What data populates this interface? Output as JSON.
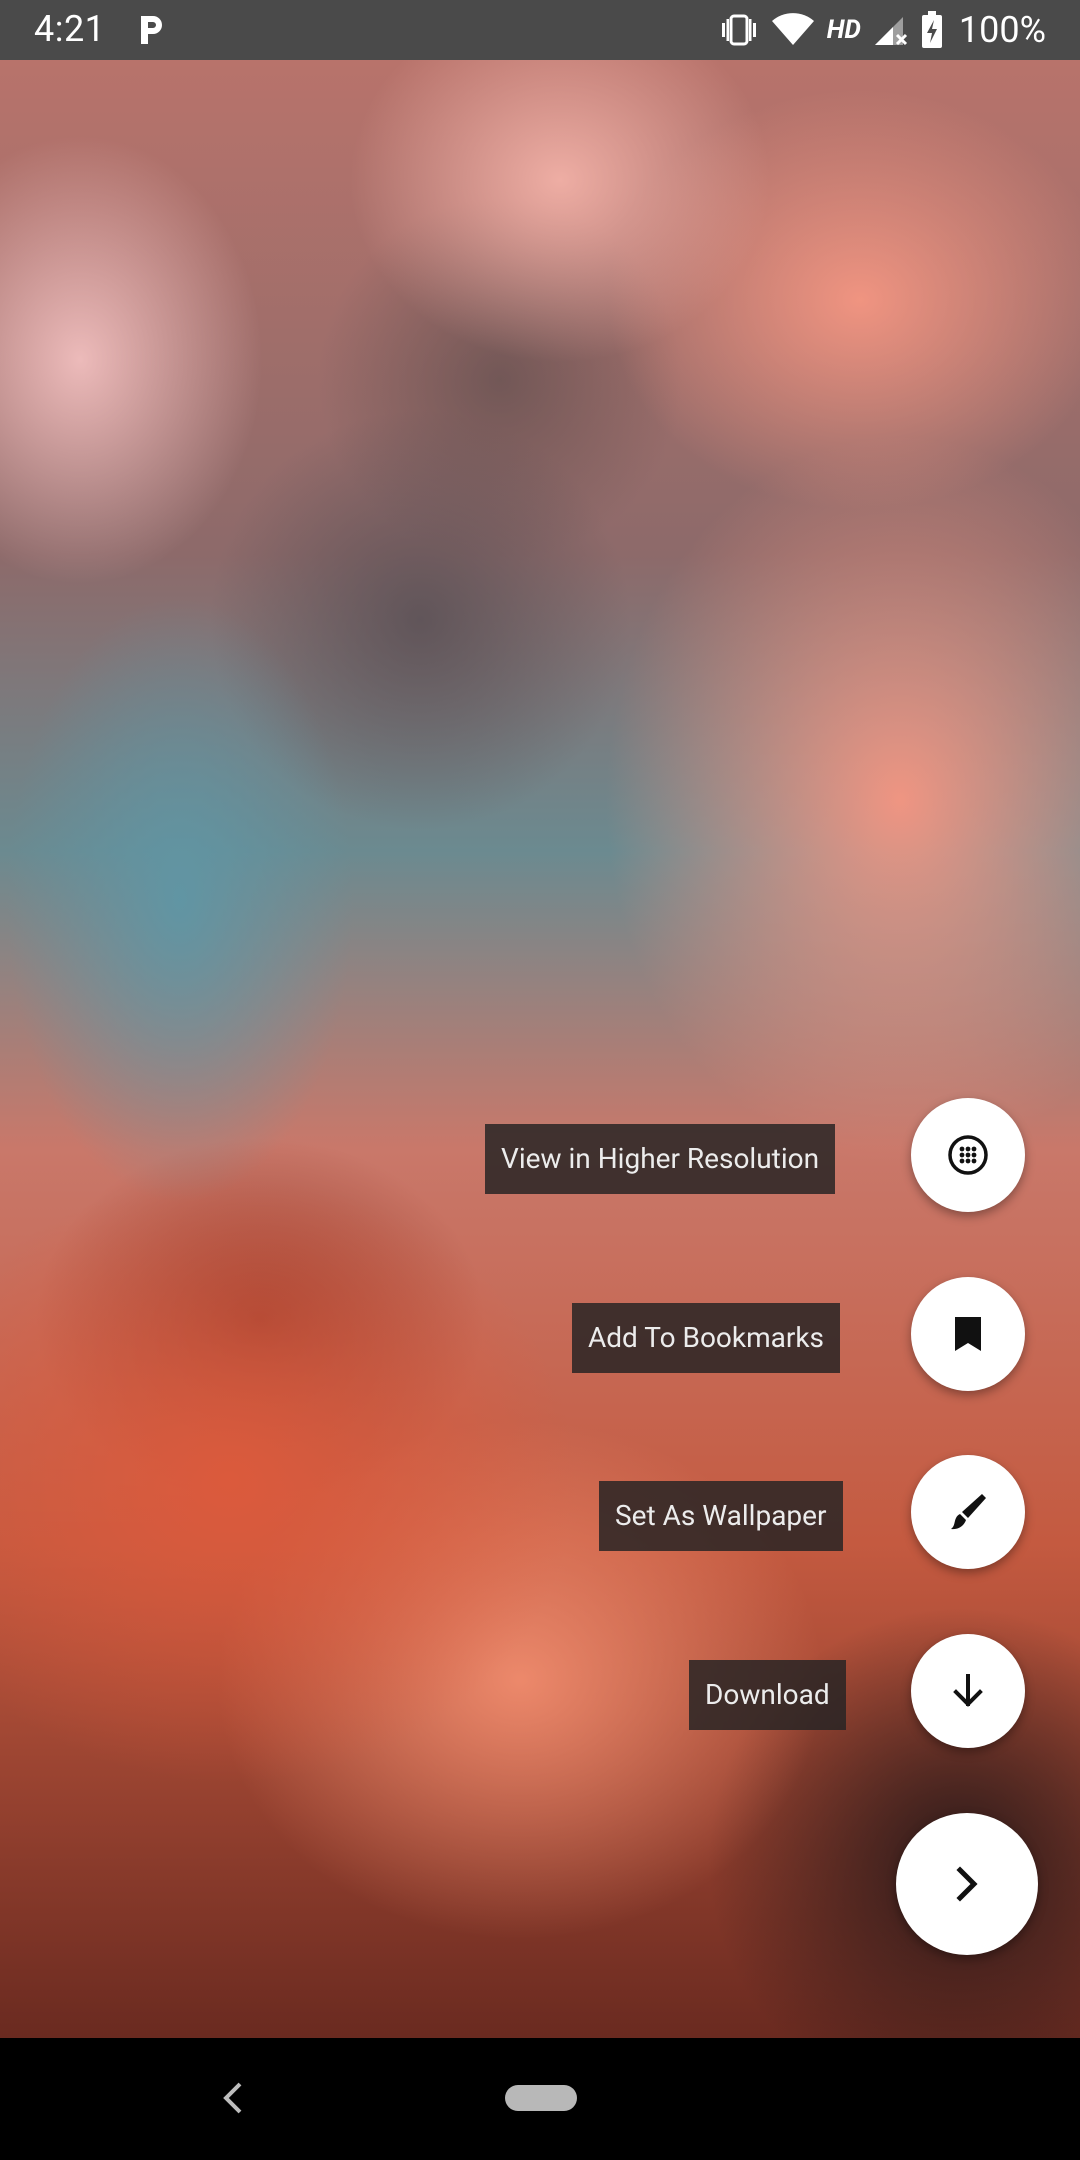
{
  "status_bar": {
    "time": "4:21",
    "network_label": "HD",
    "battery": "100%",
    "icons": [
      "parking-icon",
      "vibrate-icon",
      "wifi-icon",
      "signal-icon",
      "battery-charging-icon"
    ]
  },
  "wallpaper": {
    "description_colors": [
      "#b8736b",
      "#6b8a90",
      "#c45a40"
    ]
  },
  "speed_dial": {
    "actions": [
      {
        "label": "View in Higher Resolution",
        "icon": "high-resolution-icon"
      },
      {
        "label": "Add To Bookmarks",
        "icon": "bookmark-icon"
      },
      {
        "label": "Set As Wallpaper",
        "icon": "brush-icon"
      },
      {
        "label": "Download",
        "icon": "download-icon"
      }
    ],
    "main_icon": "chevron-right-icon"
  },
  "nav_bar": {
    "icons": [
      "back-icon",
      "home-pill"
    ]
  }
}
